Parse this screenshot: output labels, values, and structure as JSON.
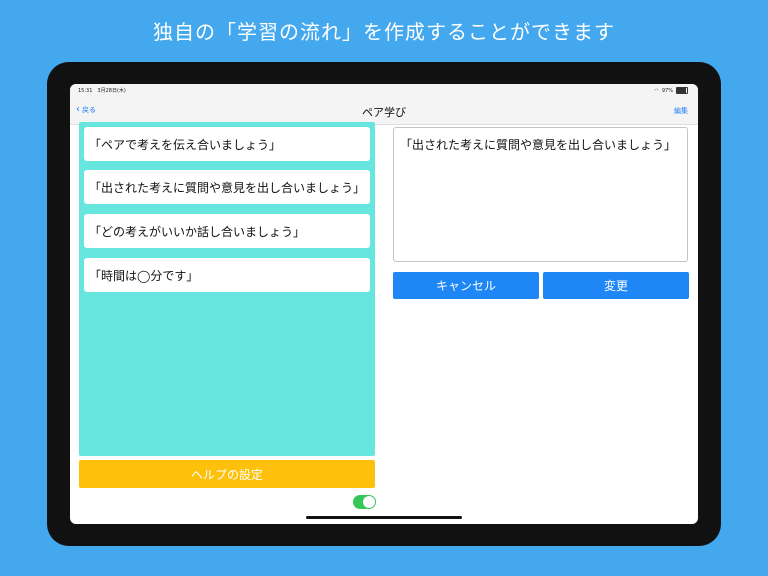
{
  "headline": "独自の「学習の流れ」を作成することができます",
  "status_bar": {
    "time": "15:31　3月28日(木)",
    "battery": "97%"
  },
  "nav": {
    "back_label": "戻る",
    "title": "ペア学び",
    "edit_label": "編集"
  },
  "flow_items": [
    {
      "label": "「ペアで考えを伝え合いましょう」"
    },
    {
      "label": "「出された考えに質問や意見を出し合いましょう」"
    },
    {
      "label": "「どの考えがいいか話し合いましょう」"
    },
    {
      "label": "「時間は◯分です」"
    }
  ],
  "help_button_label": "ヘルプの設定",
  "toggle": {
    "on": true
  },
  "editor": {
    "value": "「出された考えに質問や意見を出し合いましょう」"
  },
  "cancel_label": "キャンセル",
  "change_label": "変更",
  "colors": {
    "background": "#44a8ee",
    "panel": "#67e6df",
    "help_button": "#fdc10b",
    "action_button": "#1e87f5",
    "toggle": "#35c759"
  }
}
